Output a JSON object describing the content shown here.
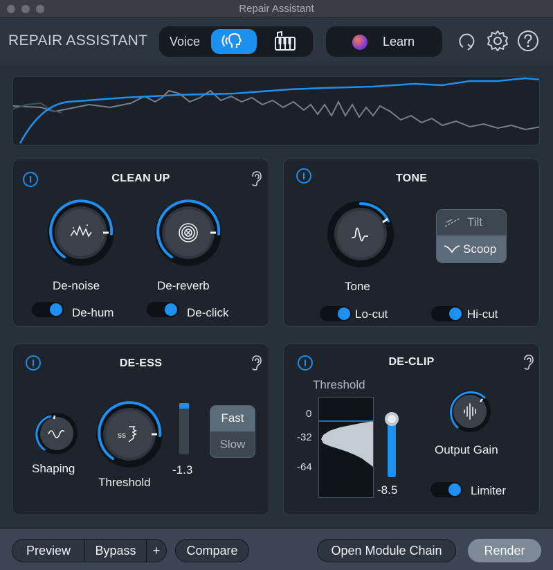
{
  "window": {
    "title": "Repair Assistant"
  },
  "header": {
    "app_title": "REPAIR ASSISTANT",
    "mode_voice_label": "Voice",
    "learn_label": "Learn"
  },
  "cleanup": {
    "title": "CLEAN UP",
    "denoise_label": "De-noise",
    "dereverb_label": "De-reverb",
    "dehum_label": "De-hum",
    "declick_label": "De-click"
  },
  "tone": {
    "title": "TONE",
    "tone_label": "Tone",
    "tilt_label": "Tilt",
    "scoop_label": "Scoop",
    "locut_label": "Lo-cut",
    "hicut_label": "Hi-cut"
  },
  "deess": {
    "title": "DE-ESS",
    "shaping_label": "Shaping",
    "threshold_label": "Threshold",
    "meter_value": "-1.3",
    "fast_label": "Fast",
    "slow_label": "Slow"
  },
  "declip": {
    "title": "DE-CLIP",
    "threshold_label": "Threshold",
    "scale": [
      "0",
      "-32",
      "-64"
    ],
    "threshold_value": "-8.5",
    "output_gain_label": "Output Gain",
    "limiter_label": "Limiter"
  },
  "footer": {
    "preview_label": "Preview",
    "bypass_label": "Bypass",
    "plus_label": "+",
    "compare_label": "Compare",
    "open_chain_label": "Open Module Chain",
    "render_label": "Render"
  },
  "colors": {
    "accent": "#1e90f2",
    "panel": "#1d242c",
    "background": "#263039"
  },
  "icons": [
    "voice-icon",
    "music-icon",
    "learn-orb-icon",
    "undo-icon",
    "gear-icon",
    "help-icon",
    "power-icon",
    "ear-icon"
  ]
}
